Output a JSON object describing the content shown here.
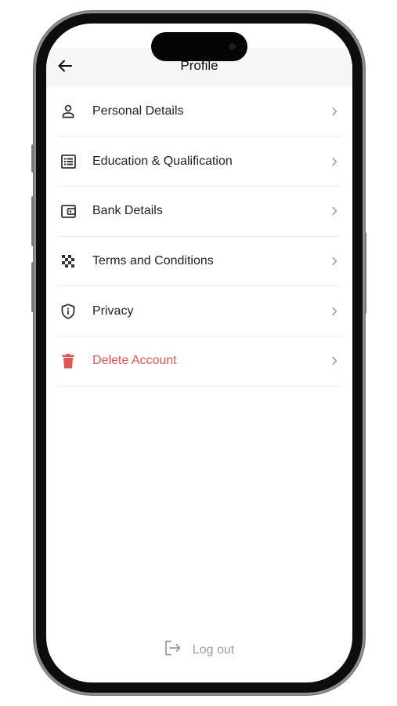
{
  "header": {
    "title": "Profile",
    "back_icon": "arrow-left-icon"
  },
  "menu": {
    "items": [
      {
        "label": "Personal Details",
        "icon": "person-icon"
      },
      {
        "label": "Education & Qualification",
        "icon": "list-document-icon"
      },
      {
        "label": "Bank Details",
        "icon": "wallet-icon"
      },
      {
        "label": "Terms and Conditions",
        "icon": "checker-icon"
      },
      {
        "label": "Privacy",
        "icon": "shield-info-icon"
      },
      {
        "label": "Delete Account",
        "icon": "trash-icon"
      }
    ]
  },
  "logout": {
    "label": "Log out",
    "icon": "logout-icon"
  },
  "colors": {
    "danger": "#e25555",
    "text": "#222222",
    "muted": "#9a9a9a",
    "header_bg": "#f6f6f6",
    "divider": "#ececec"
  }
}
